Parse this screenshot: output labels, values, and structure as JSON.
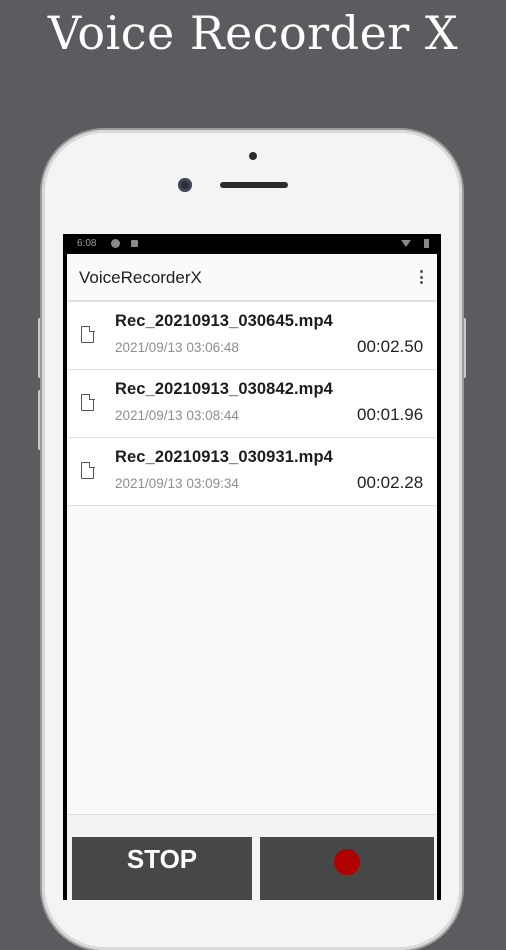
{
  "promo": {
    "title": "Voice Recorder X"
  },
  "statusbar": {
    "time": "6:08"
  },
  "app": {
    "title": "VoiceRecorderX",
    "recordings": [
      {
        "name": "Rec_20210913_030645.mp4",
        "date": "2021/09/13 03:06:48",
        "duration": "00:02.50"
      },
      {
        "name": "Rec_20210913_030842.mp4",
        "date": "2021/09/13 03:08:44",
        "duration": "00:01.96"
      },
      {
        "name": "Rec_20210913_030931.mp4",
        "date": "2021/09/13 03:09:34",
        "duration": "00:02.28"
      }
    ],
    "controls": {
      "stop_label": "STOP",
      "record_icon": "record-dot-icon",
      "record_color": "#b00000"
    }
  },
  "colors": {
    "background": "#5b5c60",
    "button": "#474747"
  }
}
